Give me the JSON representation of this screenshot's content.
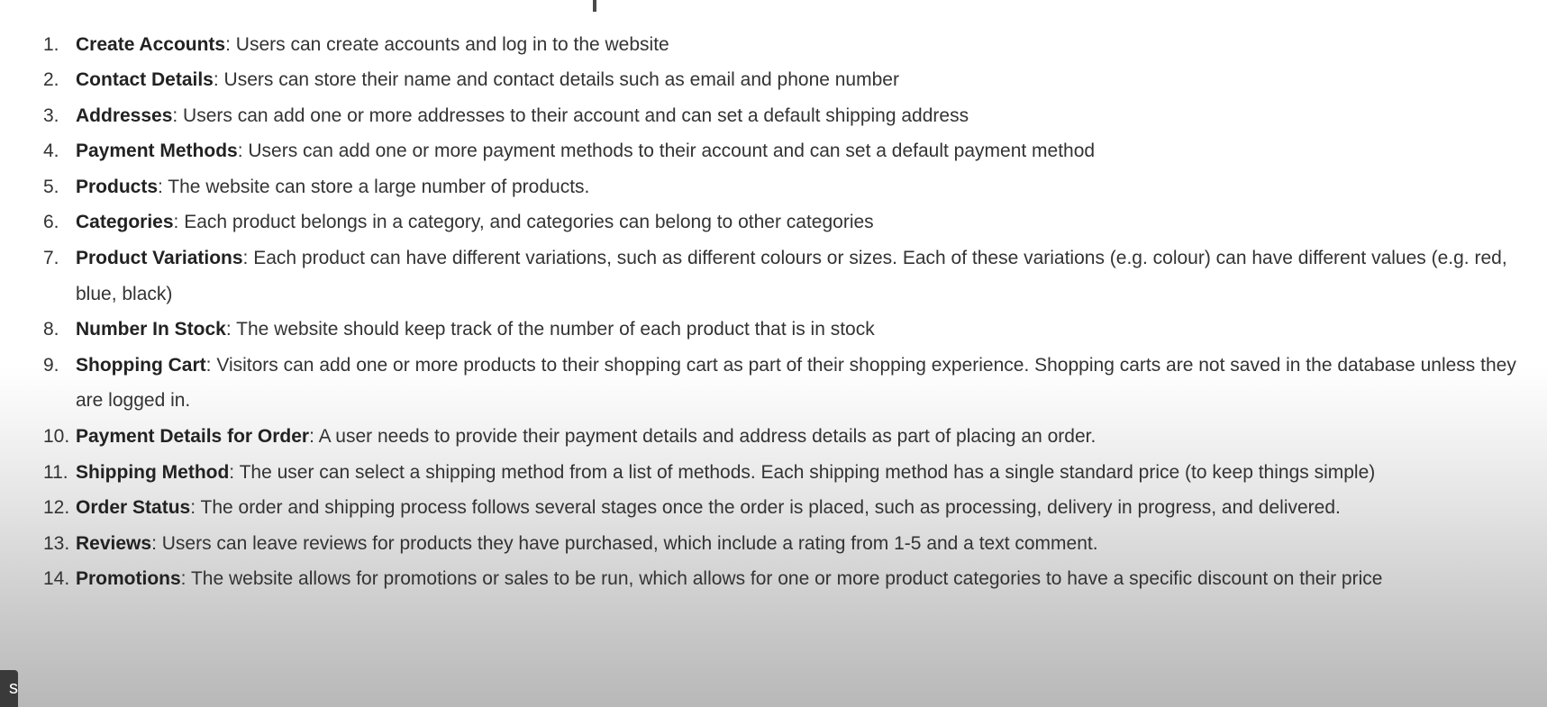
{
  "list": {
    "items": [
      {
        "number": "1.",
        "title": "Create Accounts",
        "text": ": Users can create accounts and log in to the website"
      },
      {
        "number": "2.",
        "title": "Contact Details",
        "text": ": Users can store their name and contact details such as email and phone number"
      },
      {
        "number": "3.",
        "title": "Addresses",
        "text": ": Users can add one or more addresses to their account and can set a default shipping address"
      },
      {
        "number": "4.",
        "title": "Payment Methods",
        "text": ": Users can add one or more payment methods to their account and can set a default payment method"
      },
      {
        "number": "5.",
        "title": "Products",
        "text": ": The website can store a large number of products."
      },
      {
        "number": "6.",
        "title": "Categories",
        "text": ": Each product belongs in a category, and categories can belong to other categories"
      },
      {
        "number": "7.",
        "title": "Product Variations",
        "text": ": Each product can have different variations, such as different colours or sizes. Each of these variations (e.g. colour) can have different values (e.g. red, blue, black)"
      },
      {
        "number": "8.",
        "title": "Number In Stock",
        "text": ": The website should keep track of the number of each product that is in stock"
      },
      {
        "number": "9.",
        "title": "Shopping Cart",
        "text": ": Visitors can add one or more products to their shopping cart as part of their shopping experience. Shopping carts are not saved in the database unless they are logged in."
      },
      {
        "number": "10.",
        "title": "Payment Details for Order",
        "text": ": A user needs to provide their payment details and address details as part of placing an order."
      },
      {
        "number": "11.",
        "title": "Shipping Method",
        "text": ": The user can select a shipping method from a list of methods. Each shipping method has a single standard price (to keep things simple)"
      },
      {
        "number": "12.",
        "title": "Order Status",
        "text": ": The order and shipping process follows several stages once the order is placed, such as processing, delivery in progress, and delivered."
      },
      {
        "number": "13.",
        "title": "Reviews",
        "text": ": Users can leave reviews for products they have purchased, which include a rating from 1-5 and a text comment."
      },
      {
        "number": "14.",
        "title": "Promotions",
        "text": ": The website allows for promotions or sales to be run, which allows for one or more product categories to have a specific discount on their price"
      }
    ]
  },
  "corner_badge": {
    "label": "s"
  }
}
